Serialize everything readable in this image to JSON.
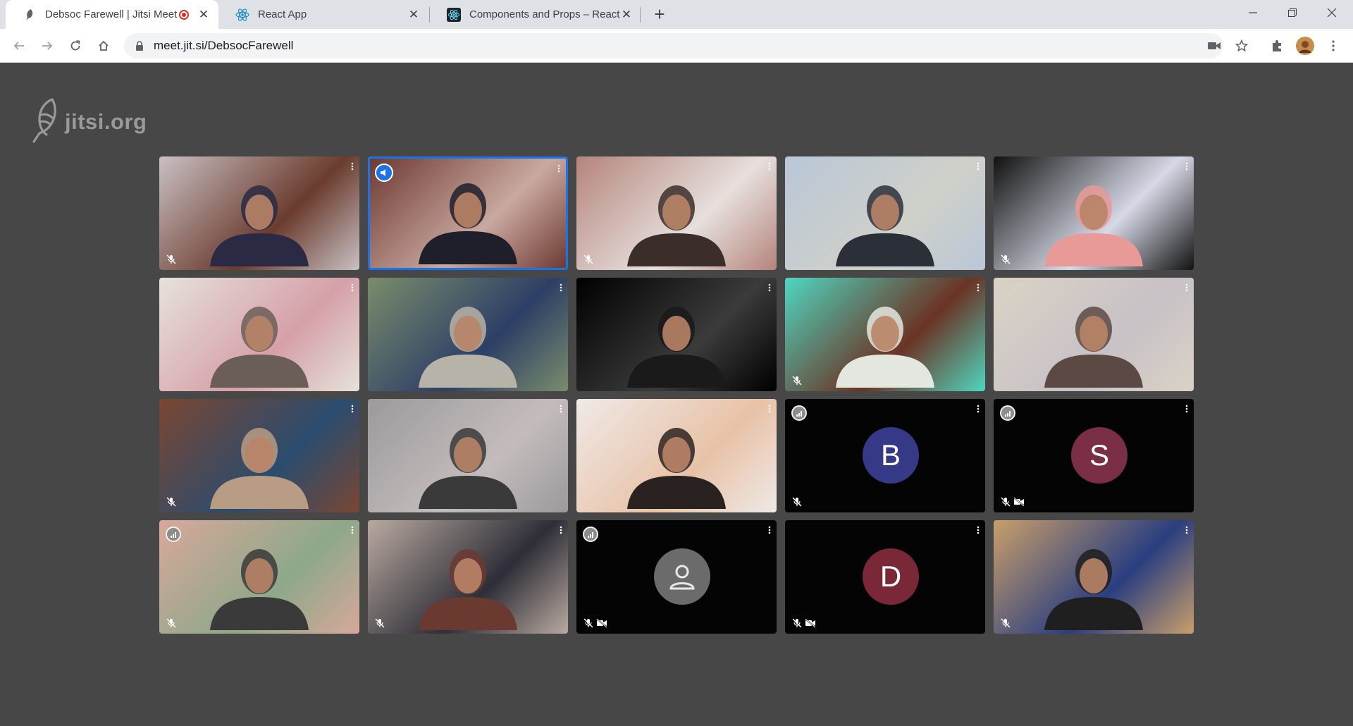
{
  "browser": {
    "tabs": [
      {
        "title": "Debsoc Farewell | Jitsi Meet",
        "active": true,
        "recording": true
      },
      {
        "title": "React App",
        "active": false
      },
      {
        "title": "Components and Props – React",
        "active": false
      }
    ],
    "url": "meet.jit.si/DebsocFarewell"
  },
  "page": {
    "logo_text": "jitsi.org"
  },
  "participants": [
    {
      "type": "video",
      "colors": [
        "#c9c0c4",
        "#6b3c2e",
        "#2a2a44"
      ],
      "muted": true
    },
    {
      "type": "video",
      "colors": [
        "#6e3a33",
        "#c9a9a0",
        "#1f1f2b"
      ],
      "muted": false,
      "dominant": true,
      "speaking_indicator": true
    },
    {
      "type": "video",
      "colors": [
        "#b5847c",
        "#e6dfdc",
        "#3b2e2a"
      ],
      "muted": true
    },
    {
      "type": "video",
      "colors": [
        "#b9c7d8",
        "#cfd0c9",
        "#2b2f38"
      ],
      "muted": false
    },
    {
      "type": "video",
      "colors": [
        "#111111",
        "#d6d9e6",
        "#e79a98"
      ],
      "muted": true
    },
    {
      "type": "video",
      "colors": [
        "#e6e2dc",
        "#d5a0a8",
        "#6b5e57"
      ],
      "muted": false
    },
    {
      "type": "video",
      "colors": [
        "#7a8d6b",
        "#2d3f66",
        "#b8b3a8"
      ],
      "muted": false
    },
    {
      "type": "video",
      "colors": [
        "#000000",
        "#3b3b3b",
        "#1a1a1a"
      ],
      "muted": false
    },
    {
      "type": "video",
      "colors": [
        "#4fd6c0",
        "#6b3324",
        "#e4e7e0"
      ],
      "muted": true
    },
    {
      "type": "video",
      "colors": [
        "#d9d3c5",
        "#c8c1c6",
        "#5b4a44"
      ],
      "muted": false
    },
    {
      "type": "video",
      "colors": [
        "#7a4632",
        "#2b4c6e",
        "#b89c84"
      ],
      "muted": true
    },
    {
      "type": "video",
      "colors": [
        "#9c9a9c",
        "#c4bcbc",
        "#3a3a3a"
      ],
      "muted": false
    },
    {
      "type": "video",
      "colors": [
        "#efe9e6",
        "#e8c2a7",
        "#2a2220"
      ],
      "muted": false
    },
    {
      "type": "avatar",
      "initial": "B",
      "avatar_color": "#363a86",
      "muted": true,
      "camera_off": false,
      "connection_indicator": true
    },
    {
      "type": "avatar",
      "initial": "S",
      "avatar_color": "#7a2f47",
      "muted": true,
      "camera_off": true,
      "connection_indicator": true
    },
    {
      "type": "video",
      "colors": [
        "#d8a89a",
        "#8ea88a",
        "#3a3a3a"
      ],
      "muted": true,
      "connection_indicator": true
    },
    {
      "type": "video",
      "colors": [
        "#b9aaa0",
        "#2e2e38",
        "#6a3a30"
      ],
      "muted": true
    },
    {
      "type": "avatar",
      "initial": "",
      "avatar_color": "#6b6b6b",
      "placeholder_icon": "person-icon",
      "muted": true,
      "camera_off": true,
      "connection_indicator": true
    },
    {
      "type": "avatar",
      "initial": "D",
      "avatar_color": "#7a2838",
      "muted": true,
      "camera_off": true,
      "connection_indicator": false
    },
    {
      "type": "video",
      "colors": [
        "#c99f6a",
        "#2a3e80",
        "#1f1f1f"
      ],
      "muted": true
    }
  ]
}
